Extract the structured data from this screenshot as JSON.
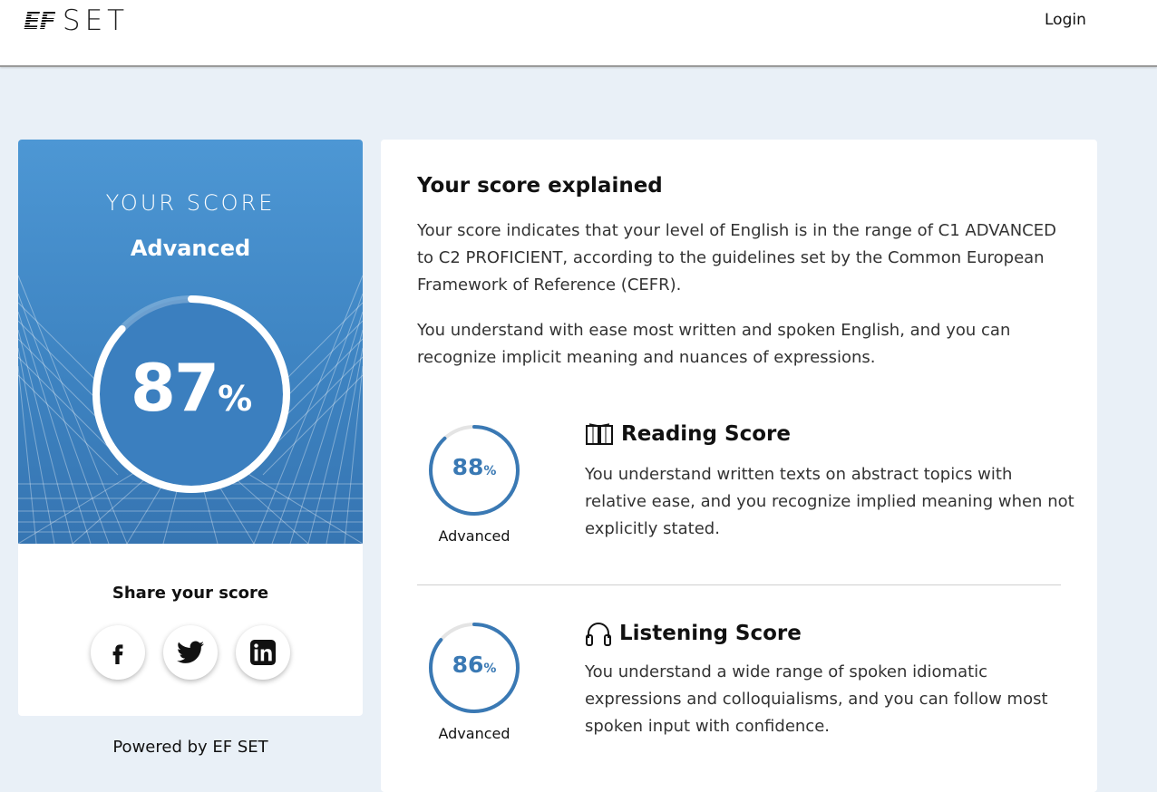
{
  "header": {
    "logo_mark": "EF",
    "logo_text": "SET",
    "login_label": "Login"
  },
  "score_card": {
    "your_score_label": "YOUR SCORE",
    "level": "Advanced",
    "percent_value": "87",
    "percent_symbol": "%",
    "progress": 0.87,
    "share_title": "Share your score",
    "share_buttons": [
      "facebook",
      "twitter",
      "linkedin"
    ]
  },
  "powered_by": "Powered by EF SET",
  "explanation": {
    "title": "Your score explained",
    "paragraph1": "Your score indicates that your level of English is in the range of C1 ADVANCED to C2 PROFICIENT, according to the guidelines set by the Common European Framework of Reference (CEFR).",
    "paragraph2": "You understand with ease most written and spoken English, and you can recognize implicit meaning and nuances of expressions.",
    "sections": [
      {
        "title": "Reading Score",
        "icon": "book-icon",
        "percent_value": "88",
        "percent_symbol": "%",
        "progress": 0.88,
        "level": "Advanced",
        "description": "You understand written texts on abstract topics with relative ease, and you recognize implied meaning when not explicitly stated."
      },
      {
        "title": "Listening Score",
        "icon": "headphones-icon",
        "percent_value": "86",
        "percent_symbol": "%",
        "progress": 0.86,
        "level": "Advanced",
        "description": "You understand a wide range of spoken idiomatic expressions and colloquialisms, and you can follow most spoken input with confidence."
      }
    ]
  },
  "colors": {
    "page_bg": "#e9f0f7",
    "score_gradient_top": "#4d97d4",
    "score_gradient_bottom": "#3675b2",
    "ring_accent": "#3a79b4"
  }
}
